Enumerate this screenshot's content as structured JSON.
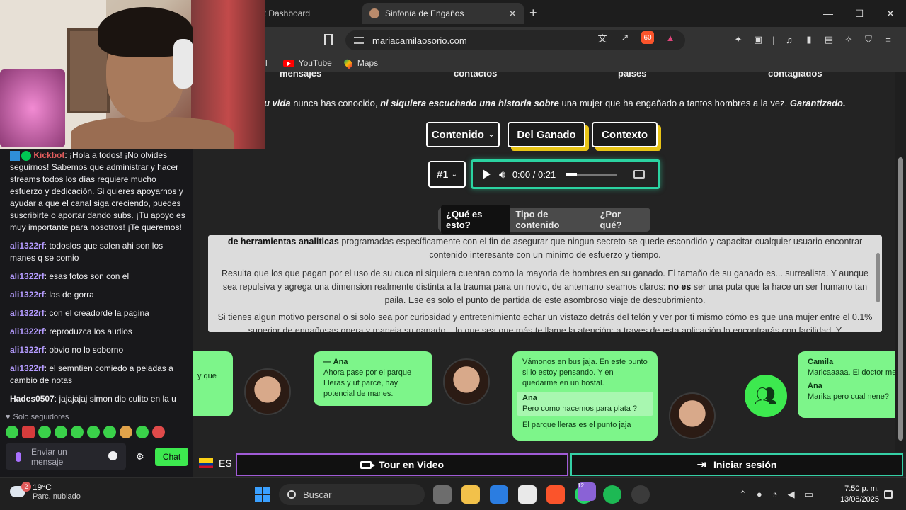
{
  "browser": {
    "tabs": [
      {
        "label": "k Dashboard",
        "active": false
      },
      {
        "label": "Sinfonía de Engaños",
        "active": true
      }
    ],
    "url": "mariacamilaosorio.com",
    "bookmarks": [
      "YouTube",
      "Maps"
    ],
    "bookmark_partial": "l",
    "shield_count": "60"
  },
  "chat": {
    "messages": [
      {
        "user": "Kickbot",
        "text": "¡Hola a todos! ¡No olvides seguirnos! Sabemos que administrar y hacer streams todos los días requiere mucho esfuerzo y dedicación. Si quieres apoyarnos y ayudar a que el canal siga creciendo, puedes suscribirte o aportar dando subs. ¡Tu apoyo es muy importante para nosotros! ¡Te queremos!"
      },
      {
        "user": "ali1322rf",
        "text": "todoslos que salen ahi son los manes q se comio"
      },
      {
        "user": "ali1322rf",
        "text": "esas fotos son con el"
      },
      {
        "user": "ali1322rf",
        "text": "las de gorra"
      },
      {
        "user": "ali1322rf",
        "text": "con el creadorde la pagina"
      },
      {
        "user": "ali1322rf",
        "text": "reproduzca los audios"
      },
      {
        "user": "ali1322rf",
        "text": "obvio no lo soborno"
      },
      {
        "user": "ali1322rf",
        "text": "el semntien comiedo a peladas a cambio de notas"
      },
      {
        "user": "Hades0507",
        "text": "jajajajaj simon dio culito en la u"
      }
    ],
    "followers_only": "Solo seguidores",
    "input_placeholder": "Enviar un mensaje",
    "send_label": "Chat"
  },
  "page": {
    "stats_cut": [
      "mensajes",
      "contactos",
      "países",
      "contagiados"
    ],
    "tagline": {
      "part1": "u vida",
      "part2": " nunca has conocido, ",
      "part3": "ni siquiera escuchado una historia sobre",
      "part4": " una mujer que ha engañado a tantos hombres a la vez. ",
      "part5": "Garantizado."
    },
    "categories": [
      {
        "label": "Contenido",
        "selected": true
      },
      {
        "label": "Del Ganado",
        "selected": false
      },
      {
        "label": "Contexto",
        "selected": false
      }
    ],
    "episode": "#1",
    "player": {
      "time": "0:00 / 0:21",
      "progress": 0.0
    },
    "info_tabs": [
      {
        "label": "¿Qué es esto?",
        "selected": true
      },
      {
        "label": "Tipo de contenido",
        "selected": false
      },
      {
        "label": "¿Por qué?",
        "selected": false
      }
    ],
    "text_paragraphs": {
      "p1_bold": "de herramientas analiticas",
      "p1": " programadas específicamente con el fin de asegurar que ningun secreto se quede escondido y capacitar cualquier usuario encontrar contenido interesante con un minimo de esfuerzo y tiempo.",
      "p2a": "Resulta que los que pagan por el uso de su cuca ni siquiera cuentan como la mayoria de hombres en su ganado. El tamaño de su ganado es... surrealista. Y aunque sea repulsiva y agrega una dimension realmente distinta a la trauma para un novio, de antemano seamos claros: ",
      "p2_bold": "no es",
      "p2b": " ser una puta que la hace un ser humano tan paila. Ese es solo el punto de partida de este asombroso viaje de descubrimiento.",
      "p3": "Si tienes algun motivo personal o si solo sea por curiosidad y entretenimiento echar un vistazo detrás del telón y ver por ti mismo cómo es que una mujer entre el 0.1% superior de engañosas opera y maneja su ganado... lo que sea que más te llame la atención: a traves de esta aplicación lo encontrarás con facilidad. Y"
    },
    "bubbles": {
      "b0_text": "y que",
      "b1_sender": "— Ana",
      "b1_text": "Ahora pase por el parque Lleras y uf parce, hay potencial de manes.",
      "b2_text": "Vámonos en bus jaja. En este punto si lo estoy pensando. Y en quedarme en un hostal.",
      "b2_reply_sender": "Ana",
      "b2_reply_text": "Pero como hacemos para plata ?",
      "b2_footer": "El parque lleras es el punto jaja",
      "b3_sender1": "Camila",
      "b3_text1": "Maricaaaaa. El doctor me",
      "b3_sender2": "Ana",
      "b3_text2": "Marika pero cual nene?"
    },
    "bottom": {
      "lang": "ES",
      "tour": "Tour en Video",
      "login": "Iniciar sesión"
    }
  },
  "taskbar": {
    "weather_badge": "2",
    "temp": "19°C",
    "condition": "Parc. nublado",
    "search": "Buscar",
    "whatsapp_badge": "12",
    "time": "7:50 p. m.",
    "date": "13/08/2025"
  }
}
